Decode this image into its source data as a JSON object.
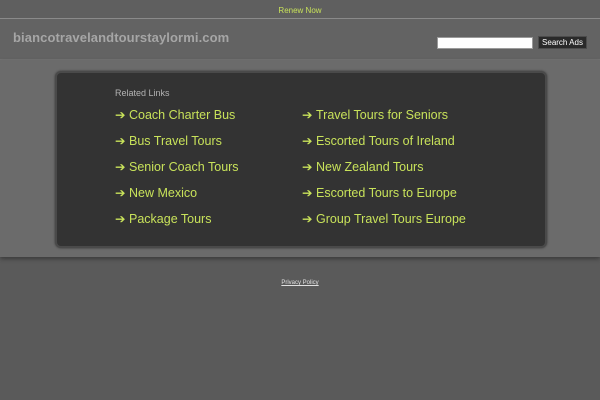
{
  "topbar": {
    "renew_label": "Renew Now"
  },
  "header": {
    "domain_title": "biancotravelandtourstaylormi.com",
    "search_value": "",
    "search_button_label": "Search Ads"
  },
  "related": {
    "heading": "Related Links",
    "arrow_icon": "arrow-right-icon",
    "arrow_glyph": "➔",
    "left_links": [
      "Coach Charter Bus",
      "Bus Travel Tours",
      "Senior Coach Tours",
      "New Mexico",
      "Package Tours"
    ],
    "right_links": [
      "Travel Tours for Seniors",
      "Escorted Tours of Ireland",
      "New Zealand Tours",
      "Escorted Tours to Europe",
      "Group Travel Tours Europe"
    ]
  },
  "footer": {
    "privacy_label": "Privacy Policy"
  },
  "colors": {
    "link_accent": "#c8e25a",
    "page_background": "#5a5a5a",
    "panel_background": "#333333"
  }
}
